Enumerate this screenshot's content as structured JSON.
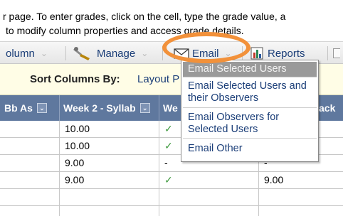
{
  "instructions": {
    "line1": "r page. To enter grades, click on the cell, type the grade value, a",
    "line2": "to modify column properties and access grade details."
  },
  "toolbar": {
    "column_label": "olumn",
    "manage_label": "Manage",
    "email_label": "Email",
    "reports_label": "Reports"
  },
  "sort": {
    "label": "Sort Columns By:",
    "value": "Layout P"
  },
  "grid": {
    "columns": [
      "Bb As",
      "Week 2 - Syllab",
      "We",
      "ack"
    ],
    "rows": [
      [
        "10.00",
        "✓",
        ""
      ],
      [
        "10.00",
        "✓",
        ""
      ],
      [
        "9.00",
        "-",
        "-"
      ],
      [
        "9.00",
        "✓",
        "9.00"
      ],
      [
        "",
        "",
        ""
      ]
    ]
  },
  "email_menu": {
    "items": [
      "Email Selected Users",
      "Email Selected Users and their Observers",
      "Email Observers for Selected Users",
      "Email Other"
    ]
  },
  "colors": {
    "highlight": "#f2913a",
    "header_bg": "#5f789e",
    "link": "#1b3e78",
    "sort_bg": "#fffde6",
    "check": "#3f9a3f"
  }
}
